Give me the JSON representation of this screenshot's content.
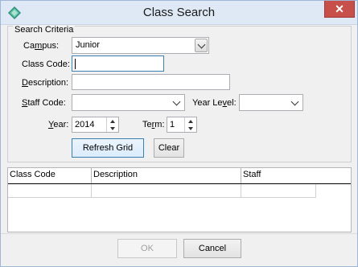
{
  "window": {
    "title": "Class Search",
    "close_glyph": "✕"
  },
  "criteria": {
    "legend": "Search Criteria",
    "campus": {
      "label_pre": "Ca",
      "label_u": "m",
      "label_post": "pus:",
      "value": "Junior"
    },
    "class_code": {
      "label": "Class Code:",
      "value": ""
    },
    "description": {
      "label_u": "D",
      "label_post": "escription:",
      "value": ""
    },
    "staff_code": {
      "label_u": "S",
      "label_post": "taff Code:",
      "value": ""
    },
    "year_level": {
      "label_pre": "Year Le",
      "label_u": "v",
      "label_post": "el:",
      "value": ""
    },
    "year": {
      "label_u": "Y",
      "label_post": "ear:",
      "value": "2014"
    },
    "term": {
      "label_pre": "Te",
      "label_u": "r",
      "label_post": "m:",
      "value": "1"
    }
  },
  "buttons": {
    "refresh": "Refresh Grid",
    "clear": "Clear",
    "ok": "OK",
    "cancel": "Cancel"
  },
  "grid": {
    "columns": [
      "Class Code",
      "Description",
      "Staff"
    ],
    "rows": []
  },
  "colors": {
    "titlebar": "#dee9f5",
    "close": "#c7504a",
    "focus": "#3c7fb1"
  }
}
